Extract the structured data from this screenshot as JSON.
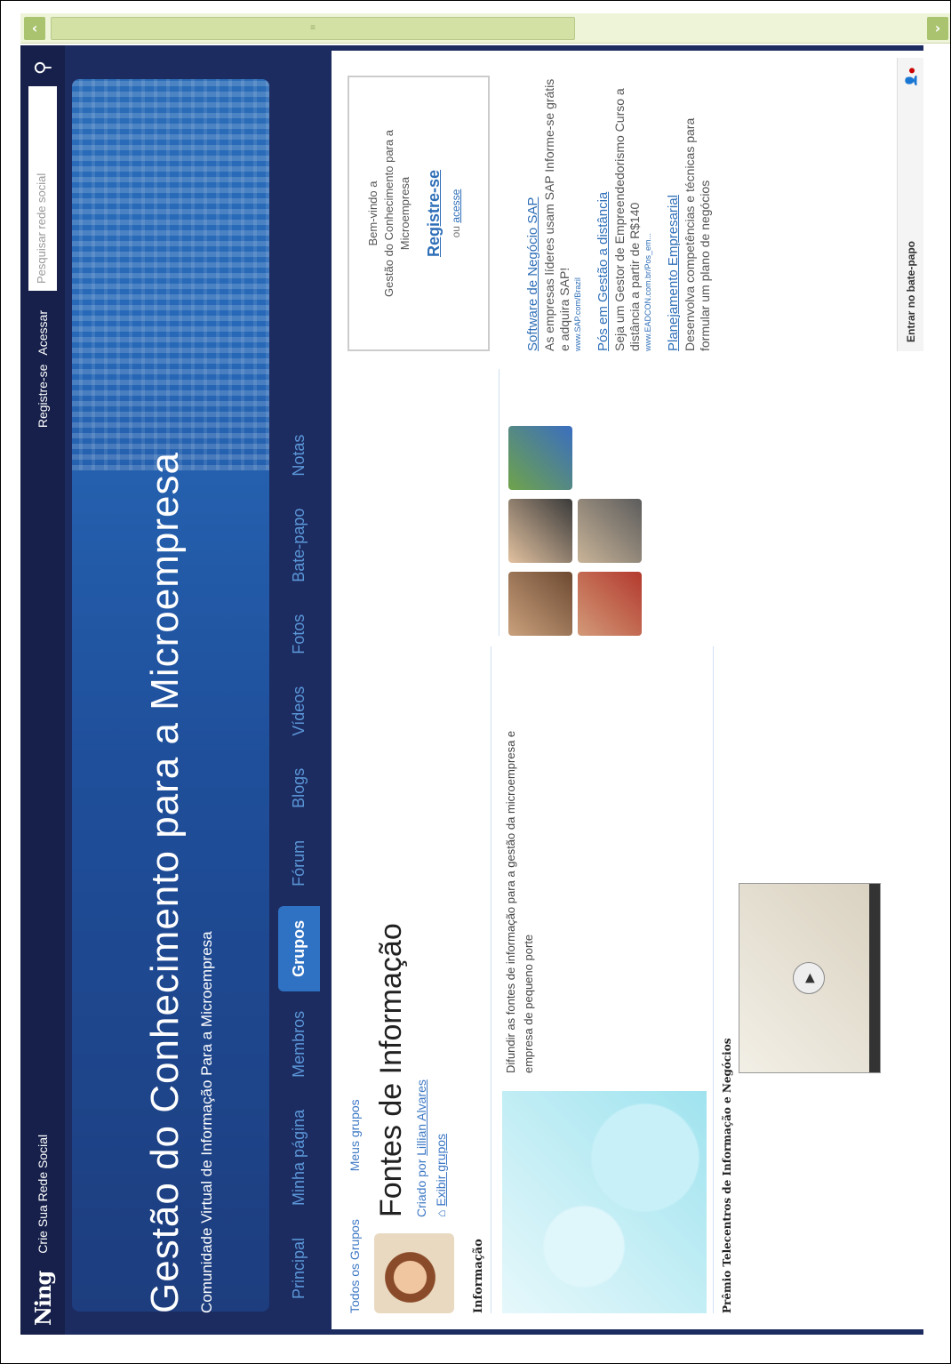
{
  "scrollbar": {
    "left_arrow": "‹",
    "right_arrow": "›",
    "thumb_grip": "≡"
  },
  "ningbar": {
    "logo": "Ning",
    "create_link": "Crie Sua Rede Social",
    "register": "Registre-se",
    "login": "Acessar",
    "search_placeholder": "Pesquisar rede social",
    "search_icon": "search-icon"
  },
  "header": {
    "title": "Gestão do Conhecimento para a Microempresa",
    "subtitle": "Comunidade Virtual de Informação Para a Microempresa"
  },
  "nav": {
    "tabs": [
      {
        "label": "Principal"
      },
      {
        "label": "Minha página"
      },
      {
        "label": "Membros"
      },
      {
        "label": "Grupos",
        "active": true
      },
      {
        "label": "Fórum"
      },
      {
        "label": "Blogs"
      },
      {
        "label": "Vídeos"
      },
      {
        "label": "Fotos"
      },
      {
        "label": "Bate-papo"
      },
      {
        "label": "Notas"
      }
    ]
  },
  "group": {
    "crumbs": {
      "all": "Todos os Grupos",
      "mine": "Meus grupos"
    },
    "title": "Fontes de Informação",
    "created_by_prefix": "Criado por",
    "creator": "Lillian Alvares",
    "view_groups": "Exibir grupos",
    "info_section": "Informação",
    "description": "Difundir as fontes de informação para a gestão da microempresa e empresa de pequeno porte",
    "premio_title": "Prêmio Telecentros de Informação e Negócios"
  },
  "welcome": {
    "line1": "Bem-vindo a",
    "line2": "Gestão do Conhecimento para a Microempresa",
    "register": "Registre-se",
    "or": "ou",
    "login": "acesse"
  },
  "ads": [
    {
      "title": "Software de Negócio SAP",
      "body": "As empresas líderes usam SAP Informe-se grátis e adquira SAP!",
      "url": "www.SAP.com/Brazil"
    },
    {
      "title": "Pós em Gestão a distância",
      "body": "Seja um Gestor de Empreendedorismo Curso a distância a partir de R$140",
      "url": "www.EADCON.com.br/Pos_em..."
    },
    {
      "title": "Planejamento Empresarial",
      "body": "Desenvolva competências e técnicas para formular um plano de negócios"
    }
  ],
  "chatbar": {
    "label": "Entrar no bate-papo"
  }
}
